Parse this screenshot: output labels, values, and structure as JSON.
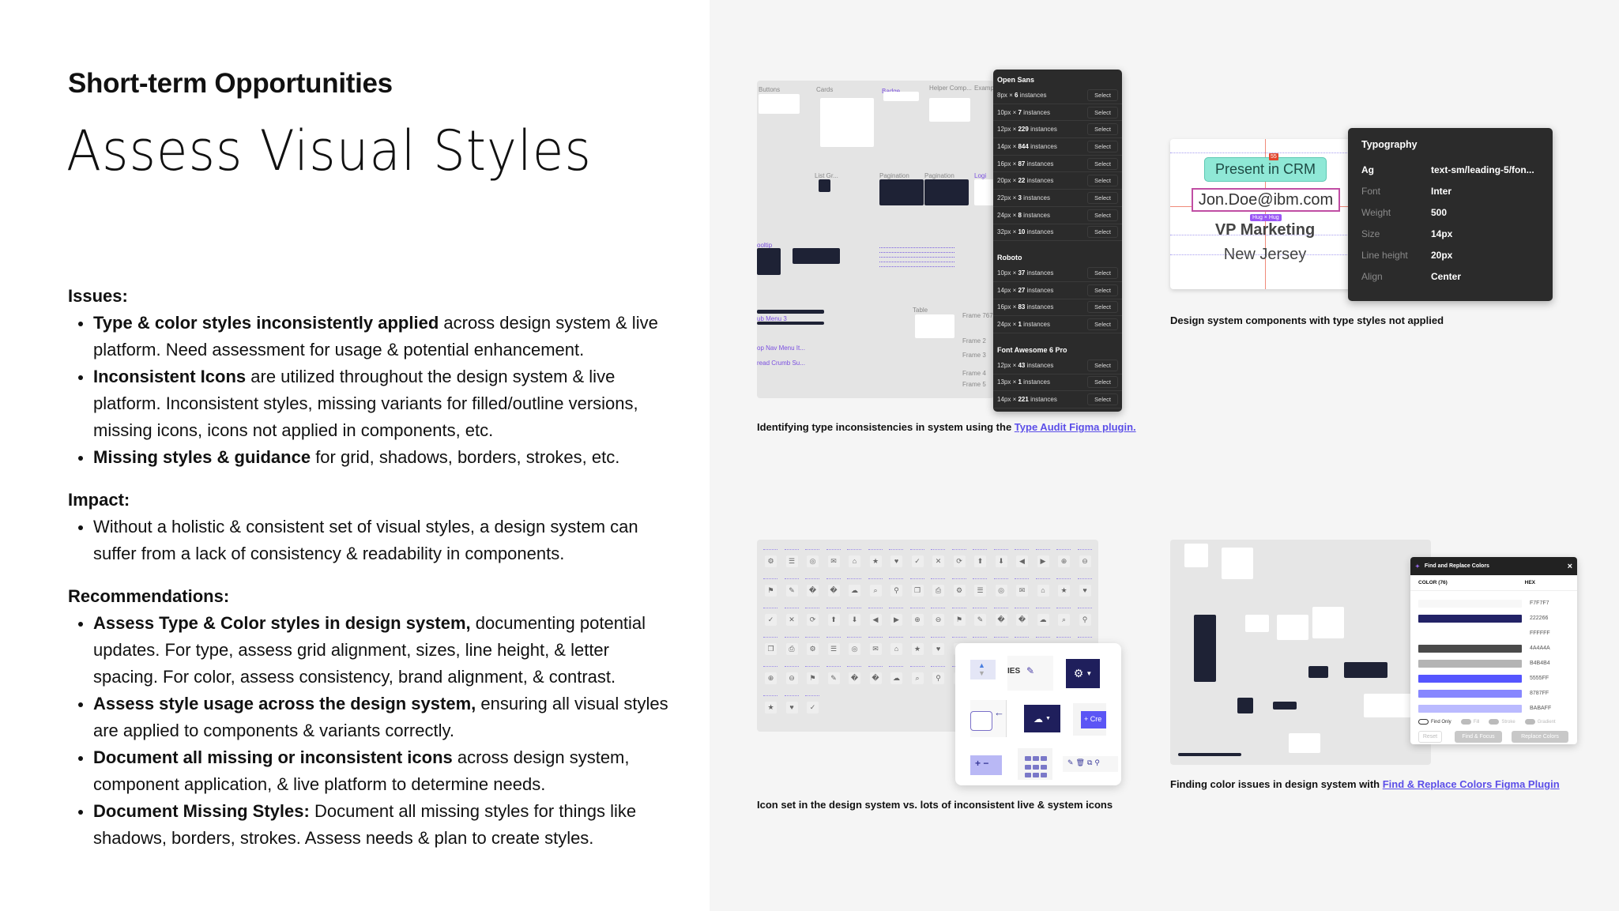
{
  "kicker": "Short-term Opportunities",
  "title": "Assess Visual Styles",
  "sections": [
    {
      "heading": "Issues:",
      "items": [
        {
          "bold": "Type & color styles inconsistently applied",
          "text": " across design system & live platform. Need assessment for usage & potential enhancement."
        },
        {
          "bold": "Inconsistent Icons",
          "text": " are utilized throughout the design system & live platform. Inconsistent styles, missing variants for filled/outline versions, missing icons, icons not applied in components, etc."
        },
        {
          "bold": "Missing styles & guidance",
          "text": " for grid, shadows, borders, strokes, etc."
        }
      ]
    },
    {
      "heading": "Impact:",
      "items": [
        {
          "bold": "",
          "text": "Without a holistic & consistent set of visual styles, a design system can suffer from a lack of consistency & readability in components."
        }
      ]
    },
    {
      "heading": "Recommendations:",
      "items": [
        {
          "bold": "Assess Type & Color styles in design system,",
          "text": " documenting potential updates. For type, assess grid alignment, sizes, line height, & letter spacing. For color, assess consistency, brand alignment, & contrast."
        },
        {
          "bold": "Assess style usage across the design system,",
          "text": " ensuring all visual styles are applied to components & variants correctly."
        },
        {
          "bold": "Document all missing or inconsistent icons",
          "text": " across design system, component application, & live platform to determine needs."
        },
        {
          "bold": "Document Missing Styles:",
          "text": " Document all missing styles for things like shadows, borders, strokes. Assess needs & plan to create styles."
        }
      ]
    }
  ],
  "type_audit": {
    "canvas_labels": [
      "Buttons",
      "Cards",
      "Badge",
      "Helper Comp...",
      "Examp",
      "List Gr...",
      "Pagination",
      "Pagination",
      "Logi",
      "ooltip",
      "Table",
      "ub Menu 3",
      "op Nav Menu It...",
      "read Crumb Su...",
      "Frame 7676",
      "Frame 2",
      "Frame 3",
      "Frame 4",
      "Frame 5"
    ],
    "select_label": "Select",
    "groups": [
      {
        "name": "Open Sans",
        "rows": [
          {
            "size": "8px",
            "count": "6"
          },
          {
            "size": "10px",
            "count": "7"
          },
          {
            "size": "12px",
            "count": "229"
          },
          {
            "size": "14px",
            "count": "844"
          },
          {
            "size": "16px",
            "count": "87"
          },
          {
            "size": "20px",
            "count": "22"
          },
          {
            "size": "22px",
            "count": "3"
          },
          {
            "size": "24px",
            "count": "8"
          },
          {
            "size": "32px",
            "count": "10"
          }
        ]
      },
      {
        "name": "Roboto",
        "rows": [
          {
            "size": "10px",
            "count": "37"
          },
          {
            "size": "14px",
            "count": "27"
          },
          {
            "size": "16px",
            "count": "83"
          },
          {
            "size": "24px",
            "count": "1"
          }
        ]
      },
      {
        "name": "Font Awesome 6 Pro",
        "rows": [
          {
            "size": "12px",
            "count": "43"
          },
          {
            "size": "13px",
            "count": "1"
          },
          {
            "size": "14px",
            "count": "221"
          }
        ]
      }
    ],
    "instances_word": "instances",
    "caption": "Identifying type inconsistencies in system using the ",
    "caption_link": "Type Audit Figma plugin."
  },
  "typography": {
    "card": {
      "badge": "Present in CRM",
      "email": "Jon.Doe@ibm.com",
      "role": "VP Marketing",
      "location": "New Jersey",
      "spacing": "55",
      "hug": "Hug × Hug"
    },
    "panel_title": "Typography",
    "rows": [
      {
        "key": "Ag",
        "value": "text-sm/leading-5/fon..."
      },
      {
        "key": "Font",
        "value": "Inter"
      },
      {
        "key": "Weight",
        "value": "500"
      },
      {
        "key": "Size",
        "value": "14px"
      },
      {
        "key": "Line height",
        "value": "20px"
      },
      {
        "key": "Align",
        "value": "Center"
      }
    ],
    "caption": "Design system components with type styles not applied"
  },
  "icons": {
    "fragment_text": "IES",
    "create_label": "+ Cre",
    "caption": "Icon set in the design system vs. lots of inconsistent live & system icons"
  },
  "colors": {
    "panel_title": "Find and Replace Colors",
    "col_color": "COLOR (76)",
    "col_hex": "HEX",
    "swatches": [
      "F7F7F7",
      "222266",
      "FFFFFF",
      "4A4A4A",
      "B4B4B4",
      "5555FF",
      "8787FF",
      "BABAFF"
    ],
    "toggles": [
      "Find Only",
      "Fill",
      "Stroke",
      "Gradient"
    ],
    "buttons": [
      "Reset",
      "Find & Focus",
      "Replace Colors"
    ],
    "caption": "Finding color issues in design system with ",
    "caption_link": "Find & Replace Colors Figma Plugin"
  },
  "accent": "#5b4ee8"
}
